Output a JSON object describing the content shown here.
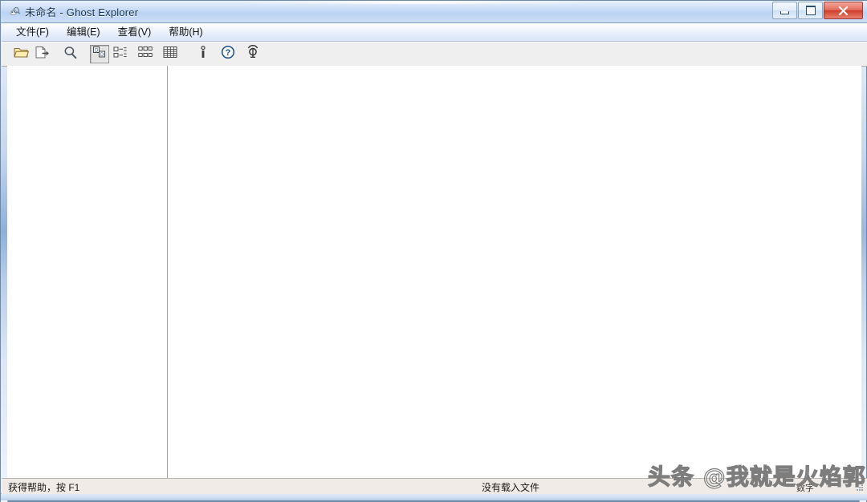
{
  "window": {
    "title": "未命名 - Ghost Explorer",
    "app_icon": "ghost-magnifier-icon",
    "controls": {
      "minimize_label": "最小化",
      "maximize_label": "最大化",
      "close_label": "关闭"
    }
  },
  "menubar": {
    "items": [
      {
        "label": "文件(F)",
        "name": "menu-file"
      },
      {
        "label": "编辑(E)",
        "name": "menu-edit"
      },
      {
        "label": "查看(V)",
        "name": "menu-view"
      },
      {
        "label": "帮助(H)",
        "name": "menu-help"
      }
    ]
  },
  "toolbar": {
    "buttons": [
      {
        "icon": "open-folder-icon",
        "label": "打开"
      },
      {
        "icon": "extract-file-icon",
        "label": "提取"
      },
      {
        "icon": "search-magnifier-icon",
        "label": "查找"
      },
      {
        "icon": "large-icons-view-icon",
        "label": "大图标",
        "pressed": true
      },
      {
        "icon": "small-icons-view-icon",
        "label": "小图标",
        "pressed": false
      },
      {
        "icon": "list-view-icon",
        "label": "列表",
        "pressed": false
      },
      {
        "icon": "details-view-icon",
        "label": "详细信息",
        "pressed": false
      },
      {
        "icon": "info-icon",
        "label": "属性"
      },
      {
        "icon": "help-question-icon",
        "label": "帮助"
      },
      {
        "icon": "about-icon",
        "label": "关于"
      }
    ]
  },
  "panes": {
    "left": {
      "name": "tree-pane",
      "content": ""
    },
    "right": {
      "name": "file-list-pane",
      "content": ""
    }
  },
  "statusbar": {
    "left_text": "获得帮助，按 F1",
    "center_text": "没有载入文件",
    "num_indicator": "数字"
  },
  "watermark": {
    "text": "头条 @我就是火焰郭"
  },
  "colors": {
    "titlebar": "#bcd3f3",
    "close_button": "#cf3f2c",
    "toolbar_bg": "#efefef",
    "statusbar_bg": "#f0ebe6",
    "pane_bg": "#ffffff"
  }
}
